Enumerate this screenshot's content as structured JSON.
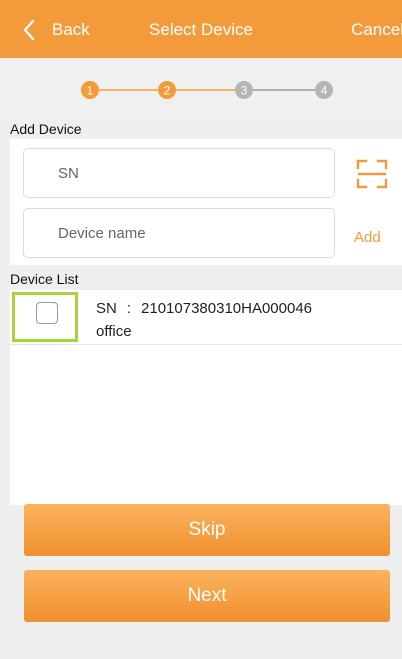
{
  "header": {
    "back_label": "Back",
    "title": "Select Device",
    "cancel_label": "Cancel"
  },
  "steps": {
    "items": [
      "1",
      "2",
      "3",
      "4"
    ],
    "current": 2,
    "active_color": "#f39a3b",
    "inactive_color": "#b4b4b4"
  },
  "add_device": {
    "section_label": "Add Device",
    "sn_placeholder": "SN",
    "name_placeholder": "Device name",
    "add_label": "Add",
    "scan_icon": "scan-icon"
  },
  "device_list": {
    "section_label": "Device List",
    "items": [
      {
        "sn_label": "SN",
        "separator": ":",
        "sn": "210107380310HA000046",
        "name": "office",
        "checked": false
      }
    ]
  },
  "buttons": {
    "skip_label": "Skip",
    "next_label": "Next"
  },
  "colors": {
    "accent": "#f39a3b",
    "highlight": "#a6d43a"
  }
}
